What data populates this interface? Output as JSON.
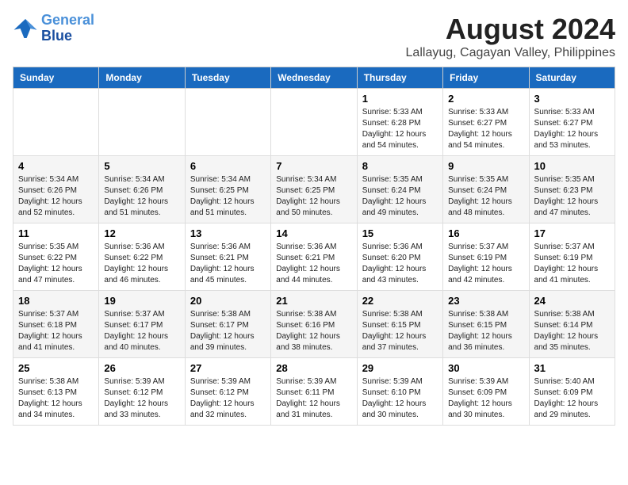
{
  "header": {
    "logo_line1": "General",
    "logo_line2": "Blue",
    "month_title": "August 2024",
    "location": "Lallayug, Cagayan Valley, Philippines"
  },
  "weekdays": [
    "Sunday",
    "Monday",
    "Tuesday",
    "Wednesday",
    "Thursday",
    "Friday",
    "Saturday"
  ],
  "weeks": [
    [
      {
        "day": "",
        "info": ""
      },
      {
        "day": "",
        "info": ""
      },
      {
        "day": "",
        "info": ""
      },
      {
        "day": "",
        "info": ""
      },
      {
        "day": "1",
        "info": "Sunrise: 5:33 AM\nSunset: 6:28 PM\nDaylight: 12 hours\nand 54 minutes."
      },
      {
        "day": "2",
        "info": "Sunrise: 5:33 AM\nSunset: 6:27 PM\nDaylight: 12 hours\nand 54 minutes."
      },
      {
        "day": "3",
        "info": "Sunrise: 5:33 AM\nSunset: 6:27 PM\nDaylight: 12 hours\nand 53 minutes."
      }
    ],
    [
      {
        "day": "4",
        "info": "Sunrise: 5:34 AM\nSunset: 6:26 PM\nDaylight: 12 hours\nand 52 minutes."
      },
      {
        "day": "5",
        "info": "Sunrise: 5:34 AM\nSunset: 6:26 PM\nDaylight: 12 hours\nand 51 minutes."
      },
      {
        "day": "6",
        "info": "Sunrise: 5:34 AM\nSunset: 6:25 PM\nDaylight: 12 hours\nand 51 minutes."
      },
      {
        "day": "7",
        "info": "Sunrise: 5:34 AM\nSunset: 6:25 PM\nDaylight: 12 hours\nand 50 minutes."
      },
      {
        "day": "8",
        "info": "Sunrise: 5:35 AM\nSunset: 6:24 PM\nDaylight: 12 hours\nand 49 minutes."
      },
      {
        "day": "9",
        "info": "Sunrise: 5:35 AM\nSunset: 6:24 PM\nDaylight: 12 hours\nand 48 minutes."
      },
      {
        "day": "10",
        "info": "Sunrise: 5:35 AM\nSunset: 6:23 PM\nDaylight: 12 hours\nand 47 minutes."
      }
    ],
    [
      {
        "day": "11",
        "info": "Sunrise: 5:35 AM\nSunset: 6:22 PM\nDaylight: 12 hours\nand 47 minutes."
      },
      {
        "day": "12",
        "info": "Sunrise: 5:36 AM\nSunset: 6:22 PM\nDaylight: 12 hours\nand 46 minutes."
      },
      {
        "day": "13",
        "info": "Sunrise: 5:36 AM\nSunset: 6:21 PM\nDaylight: 12 hours\nand 45 minutes."
      },
      {
        "day": "14",
        "info": "Sunrise: 5:36 AM\nSunset: 6:21 PM\nDaylight: 12 hours\nand 44 minutes."
      },
      {
        "day": "15",
        "info": "Sunrise: 5:36 AM\nSunset: 6:20 PM\nDaylight: 12 hours\nand 43 minutes."
      },
      {
        "day": "16",
        "info": "Sunrise: 5:37 AM\nSunset: 6:19 PM\nDaylight: 12 hours\nand 42 minutes."
      },
      {
        "day": "17",
        "info": "Sunrise: 5:37 AM\nSunset: 6:19 PM\nDaylight: 12 hours\nand 41 minutes."
      }
    ],
    [
      {
        "day": "18",
        "info": "Sunrise: 5:37 AM\nSunset: 6:18 PM\nDaylight: 12 hours\nand 41 minutes."
      },
      {
        "day": "19",
        "info": "Sunrise: 5:37 AM\nSunset: 6:17 PM\nDaylight: 12 hours\nand 40 minutes."
      },
      {
        "day": "20",
        "info": "Sunrise: 5:38 AM\nSunset: 6:17 PM\nDaylight: 12 hours\nand 39 minutes."
      },
      {
        "day": "21",
        "info": "Sunrise: 5:38 AM\nSunset: 6:16 PM\nDaylight: 12 hours\nand 38 minutes."
      },
      {
        "day": "22",
        "info": "Sunrise: 5:38 AM\nSunset: 6:15 PM\nDaylight: 12 hours\nand 37 minutes."
      },
      {
        "day": "23",
        "info": "Sunrise: 5:38 AM\nSunset: 6:15 PM\nDaylight: 12 hours\nand 36 minutes."
      },
      {
        "day": "24",
        "info": "Sunrise: 5:38 AM\nSunset: 6:14 PM\nDaylight: 12 hours\nand 35 minutes."
      }
    ],
    [
      {
        "day": "25",
        "info": "Sunrise: 5:38 AM\nSunset: 6:13 PM\nDaylight: 12 hours\nand 34 minutes."
      },
      {
        "day": "26",
        "info": "Sunrise: 5:39 AM\nSunset: 6:12 PM\nDaylight: 12 hours\nand 33 minutes."
      },
      {
        "day": "27",
        "info": "Sunrise: 5:39 AM\nSunset: 6:12 PM\nDaylight: 12 hours\nand 32 minutes."
      },
      {
        "day": "28",
        "info": "Sunrise: 5:39 AM\nSunset: 6:11 PM\nDaylight: 12 hours\nand 31 minutes."
      },
      {
        "day": "29",
        "info": "Sunrise: 5:39 AM\nSunset: 6:10 PM\nDaylight: 12 hours\nand 30 minutes."
      },
      {
        "day": "30",
        "info": "Sunrise: 5:39 AM\nSunset: 6:09 PM\nDaylight: 12 hours\nand 30 minutes."
      },
      {
        "day": "31",
        "info": "Sunrise: 5:40 AM\nSunset: 6:09 PM\nDaylight: 12 hours\nand 29 minutes."
      }
    ]
  ]
}
